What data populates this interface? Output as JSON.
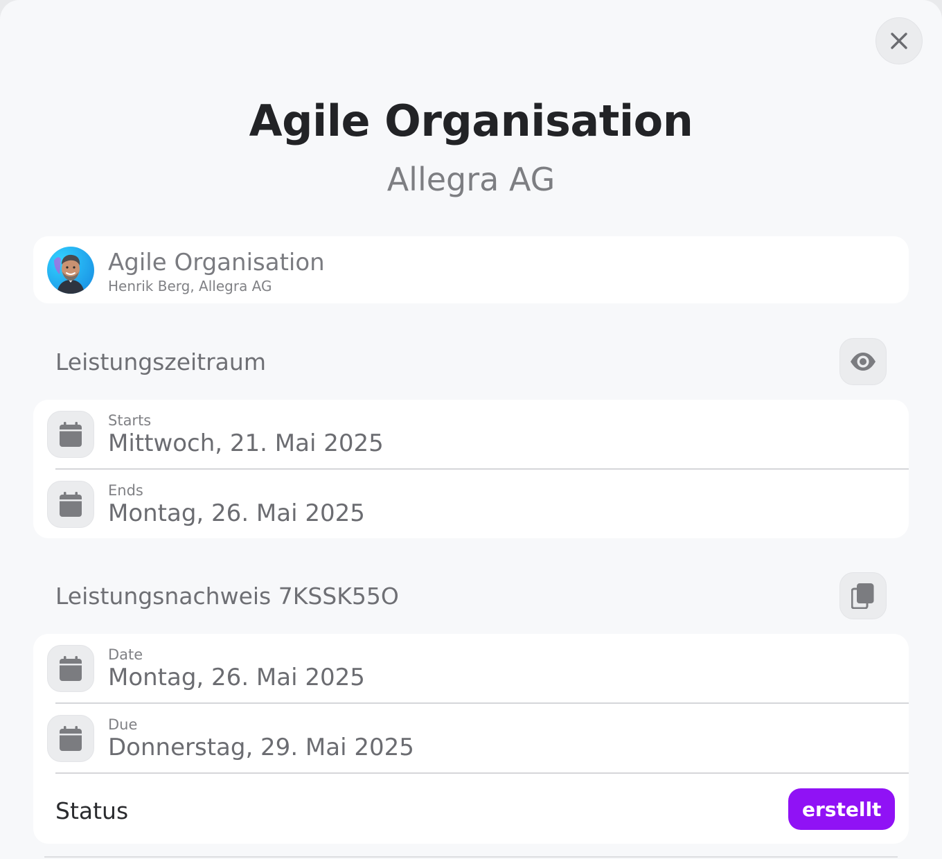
{
  "header": {
    "title": "Agile Organisation",
    "subtitle": "Allegra AG",
    "close_icon": "close-icon"
  },
  "organisation": {
    "name": "Agile Organisation",
    "meta": "Henrik Berg, Allegra AG",
    "avatar": "avatar-photo"
  },
  "period": {
    "heading": "Leistungszeitraum",
    "action_icon": "eye-icon",
    "starts": {
      "label": "Starts",
      "value": "Mittwoch, 21. Mai 2025",
      "icon": "calendar-icon"
    },
    "ends": {
      "label": "Ends",
      "value": "Montag, 26. Mai 2025",
      "icon": "calendar-icon"
    }
  },
  "proof": {
    "heading": "Leistungsnachweis 7KSSK55O",
    "action_icon": "copy-icon",
    "date": {
      "label": "Date",
      "value": "Montag, 26. Mai 2025",
      "icon": "calendar-icon"
    },
    "due": {
      "label": "Due",
      "value": "Donnerstag, 29. Mai 2025",
      "icon": "calendar-icon"
    },
    "status": {
      "label": "Status",
      "value": "erstellt",
      "color": "#9012f5"
    }
  }
}
